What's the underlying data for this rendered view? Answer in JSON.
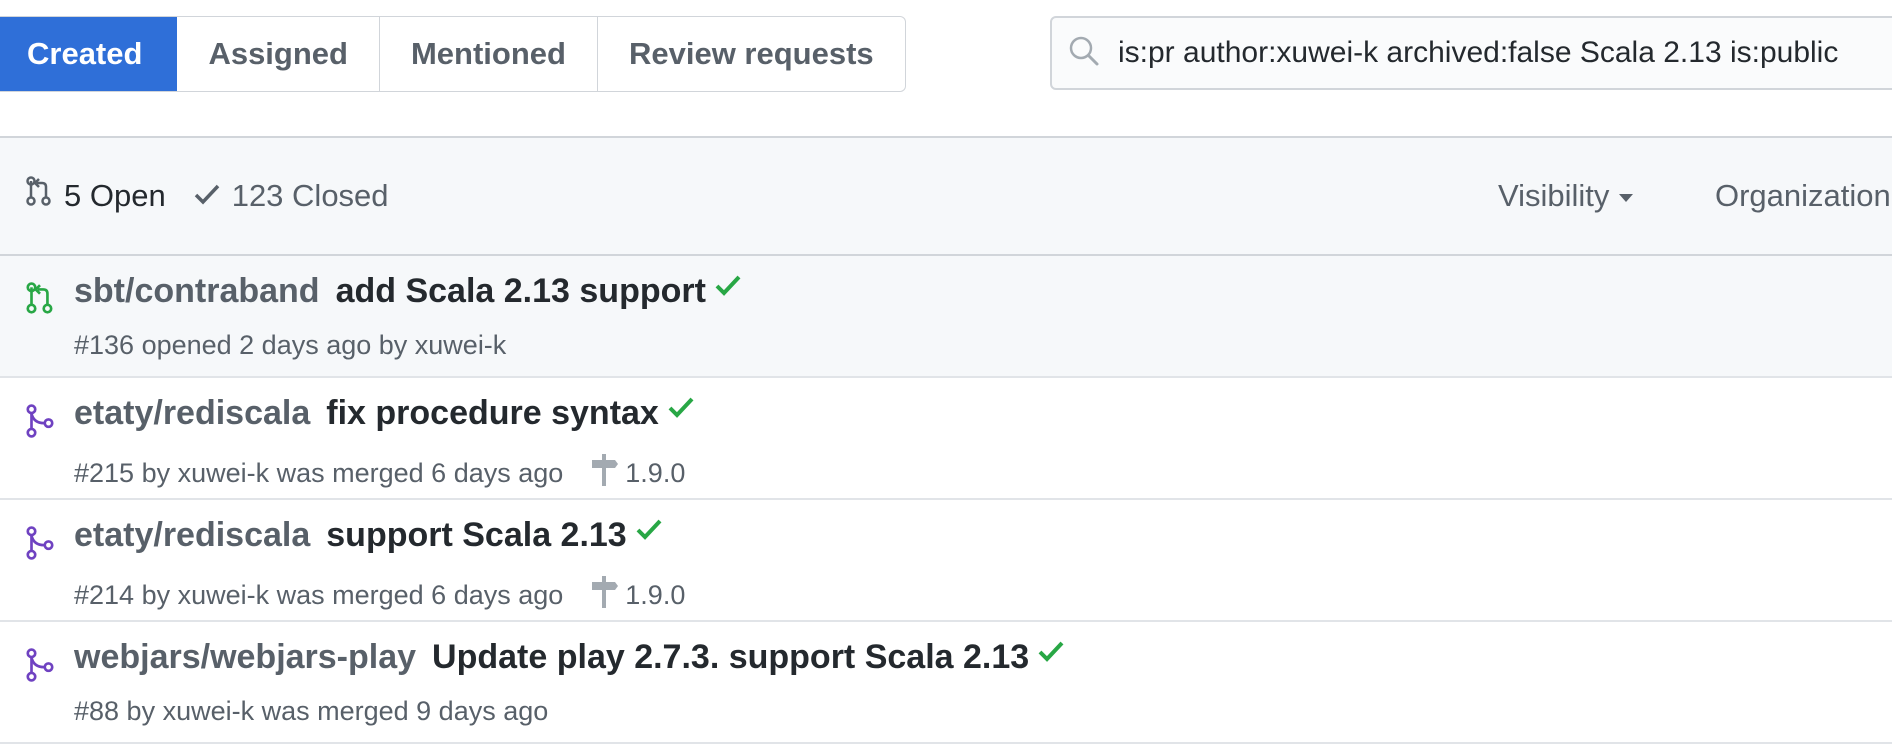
{
  "tabs": [
    {
      "label": "Created"
    },
    {
      "label": "Assigned"
    },
    {
      "label": "Mentioned"
    },
    {
      "label": "Review requests"
    }
  ],
  "search": {
    "value": "is:pr author:xuwei-k archived:false Scala 2.13 is:public"
  },
  "states": {
    "open": "5 Open",
    "closed": "123 Closed"
  },
  "filters": {
    "visibility": "Visibility",
    "organization": "Organization"
  },
  "colors": {
    "accent": "#2f6fd8",
    "open": "#28a745",
    "merged": "#6f42c1",
    "check": "#28a745"
  },
  "prs": [
    {
      "status": "open",
      "repo": "sbt/contraband",
      "title": "add Scala 2.13 support",
      "meta": "#136 opened 2 days ago by xuwei-k",
      "milestone": ""
    },
    {
      "status": "merged",
      "repo": "etaty/rediscala",
      "title": "fix procedure syntax",
      "meta": "#215 by xuwei-k was merged 6 days ago",
      "milestone": "1.9.0"
    },
    {
      "status": "merged",
      "repo": "etaty/rediscala",
      "title": "support Scala 2.13",
      "meta": "#214 by xuwei-k was merged 6 days ago",
      "milestone": "1.9.0"
    },
    {
      "status": "merged",
      "repo": "webjars/webjars-play",
      "title": "Update play 2.7.3. support Scala 2.13",
      "meta": "#88 by xuwei-k was merged 9 days ago",
      "milestone": ""
    }
  ]
}
